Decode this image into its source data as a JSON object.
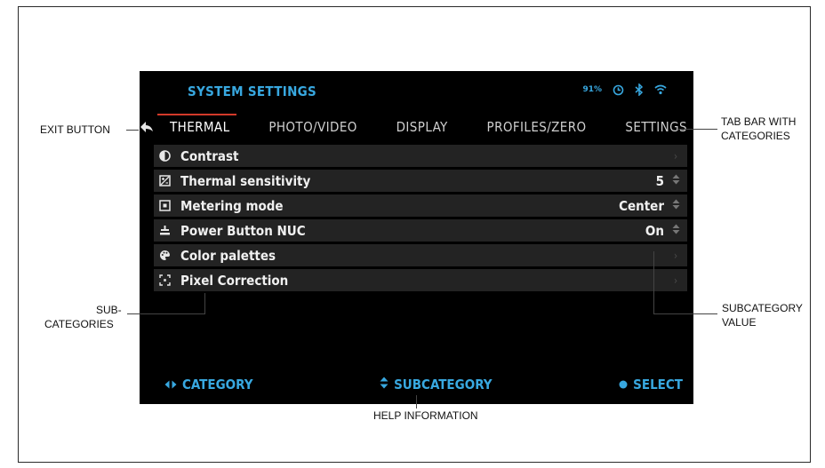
{
  "screen": {
    "title": "SYSTEM SETTINGS",
    "battery": "91%",
    "status_icons": [
      "timer-icon",
      "bluetooth-icon",
      "wifi-icon"
    ],
    "tabs": [
      {
        "label": "THERMAL",
        "active": true
      },
      {
        "label": "PHOTO/VIDEO",
        "active": false
      },
      {
        "label": "DISPLAY",
        "active": false
      },
      {
        "label": "PROFILES/ZERO",
        "active": false
      },
      {
        "label": "SETTINGS",
        "active": false
      }
    ],
    "items": [
      {
        "label": "Contrast",
        "value": "",
        "control": "chevron-right",
        "icon": "contrast-icon"
      },
      {
        "label": "Thermal sensitivity",
        "value": "5",
        "control": "updown",
        "icon": "sensitivity-icon"
      },
      {
        "label": "Metering mode",
        "value": "Center",
        "control": "updown",
        "icon": "metering-icon"
      },
      {
        "label": "Power Button NUC",
        "value": "On",
        "control": "updown",
        "icon": "nuc-icon"
      },
      {
        "label": "Color palettes",
        "value": "",
        "control": "chevron-right",
        "icon": "palette-icon"
      },
      {
        "label": "Pixel Correction",
        "value": "",
        "control": "chevron-right",
        "icon": "pixel-correction-icon"
      }
    ],
    "footer": {
      "category": "CATEGORY",
      "subcategory": "SUBCATEGORY",
      "select": "SELECT"
    },
    "colors": {
      "accent": "#38a8e0",
      "active_tab": "#d23a2a",
      "row_bg": "#232323"
    }
  },
  "annotations": {
    "exit_button": "EXIT BUTTON",
    "tab_bar_line1": "TAB BAR WITH",
    "tab_bar_line2": "CATEGORIES",
    "sub_line1": "SUB-",
    "sub_line2": "CATEGORIES",
    "value_line1": "SUBCATEGORY",
    "value_line2": "VALUE",
    "help": "HELP INFORMATION"
  }
}
